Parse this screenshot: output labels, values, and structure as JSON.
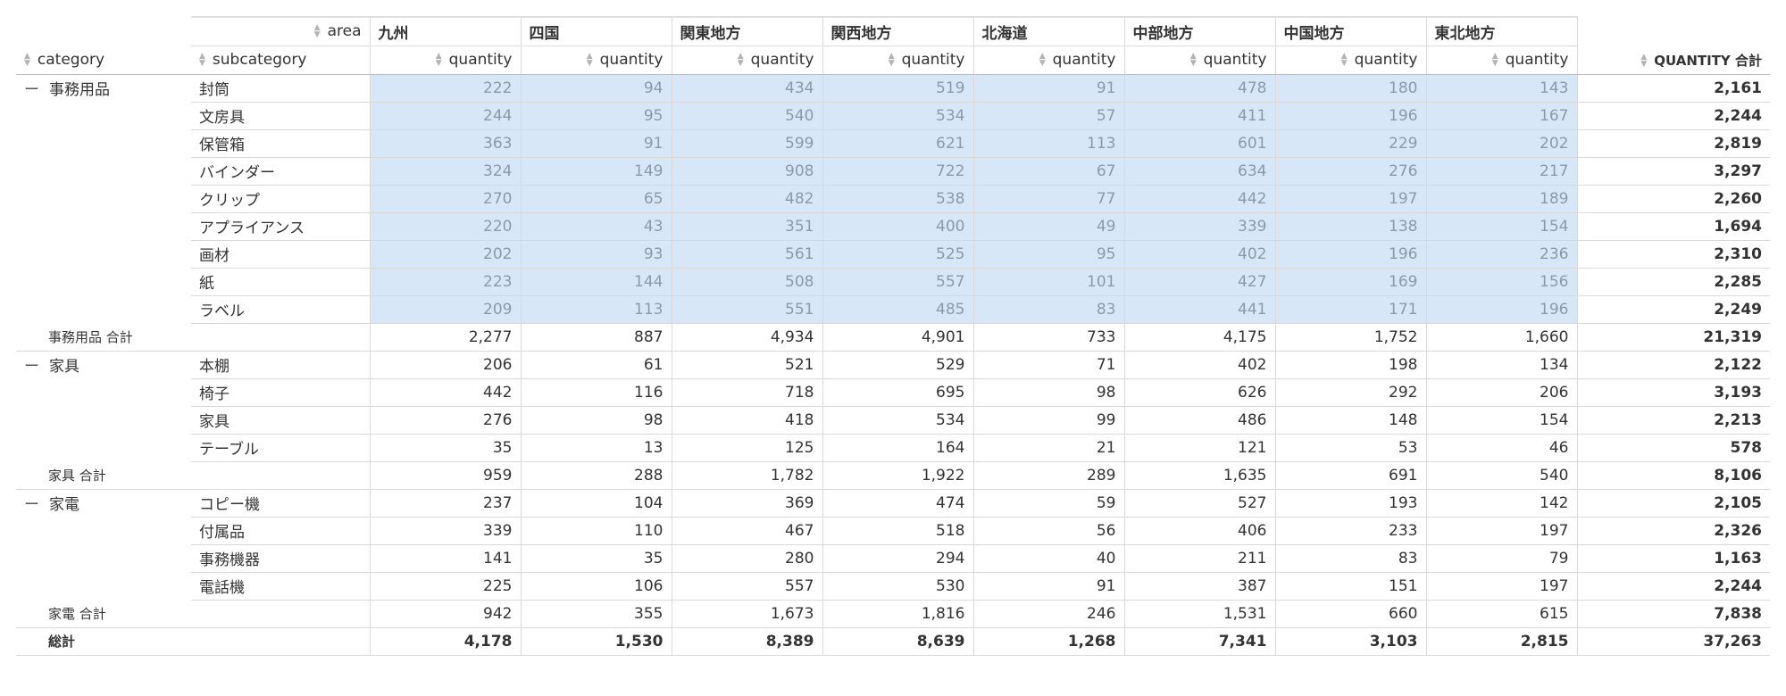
{
  "pivot": {
    "area_field": "area",
    "row_fields": [
      "category",
      "subcategory"
    ],
    "measure": "quantity",
    "total_header": "QUANTITY 合計",
    "areas": [
      "九州",
      "四国",
      "関東地方",
      "関西地方",
      "北海道",
      "中部地方",
      "中国地方",
      "東北地方"
    ],
    "groups": [
      {
        "category": "事務用品",
        "rows": [
          {
            "subcategory": "封筒",
            "values": [
              "222",
              "94",
              "434",
              "519",
              "91",
              "478",
              "180",
              "143"
            ],
            "total": "2,161"
          },
          {
            "subcategory": "文房具",
            "values": [
              "244",
              "95",
              "540",
              "534",
              "57",
              "411",
              "196",
              "167"
            ],
            "total": "2,244"
          },
          {
            "subcategory": "保管箱",
            "values": [
              "363",
              "91",
              "599",
              "621",
              "113",
              "601",
              "229",
              "202"
            ],
            "total": "2,819"
          },
          {
            "subcategory": "バインダー",
            "values": [
              "324",
              "149",
              "908",
              "722",
              "67",
              "634",
              "276",
              "217"
            ],
            "total": "3,297"
          },
          {
            "subcategory": "クリップ",
            "values": [
              "270",
              "65",
              "482",
              "538",
              "77",
              "442",
              "197",
              "189"
            ],
            "total": "2,260"
          },
          {
            "subcategory": "アプライアンス",
            "values": [
              "220",
              "43",
              "351",
              "400",
              "49",
              "339",
              "138",
              "154"
            ],
            "total": "1,694"
          },
          {
            "subcategory": "画材",
            "values": [
              "202",
              "93",
              "561",
              "525",
              "95",
              "402",
              "196",
              "236"
            ],
            "total": "2,310"
          },
          {
            "subcategory": "紙",
            "values": [
              "223",
              "144",
              "508",
              "557",
              "101",
              "427",
              "169",
              "156"
            ],
            "total": "2,285"
          },
          {
            "subcategory": "ラベル",
            "values": [
              "209",
              "113",
              "551",
              "485",
              "83",
              "441",
              "171",
              "196"
            ],
            "total": "2,249"
          }
        ],
        "subtotal_label": "事務用品 合計",
        "subtotal": [
          "2,277",
          "887",
          "4,934",
          "4,901",
          "733",
          "4,175",
          "1,752",
          "1,660"
        ],
        "subtotal_total": "21,319"
      },
      {
        "category": "家具",
        "rows": [
          {
            "subcategory": "本棚",
            "values": [
              "206",
              "61",
              "521",
              "529",
              "71",
              "402",
              "198",
              "134"
            ],
            "total": "2,122"
          },
          {
            "subcategory": "椅子",
            "values": [
              "442",
              "116",
              "718",
              "695",
              "98",
              "626",
              "292",
              "206"
            ],
            "total": "3,193"
          },
          {
            "subcategory": "家具",
            "values": [
              "276",
              "98",
              "418",
              "534",
              "99",
              "486",
              "148",
              "154"
            ],
            "total": "2,213"
          },
          {
            "subcategory": "テーブル",
            "values": [
              "35",
              "13",
              "125",
              "164",
              "21",
              "121",
              "53",
              "46"
            ],
            "total": "578"
          }
        ],
        "subtotal_label": "家具 合計",
        "subtotal": [
          "959",
          "288",
          "1,782",
          "1,922",
          "289",
          "1,635",
          "691",
          "540"
        ],
        "subtotal_total": "8,106"
      },
      {
        "category": "家電",
        "rows": [
          {
            "subcategory": "コピー機",
            "values": [
              "237",
              "104",
              "369",
              "474",
              "59",
              "527",
              "193",
              "142"
            ],
            "total": "2,105"
          },
          {
            "subcategory": "付属品",
            "values": [
              "339",
              "110",
              "467",
              "518",
              "56",
              "406",
              "233",
              "197"
            ],
            "total": "2,326"
          },
          {
            "subcategory": "事務機器",
            "values": [
              "141",
              "35",
              "280",
              "294",
              "40",
              "211",
              "83",
              "79"
            ],
            "total": "1,163"
          },
          {
            "subcategory": "電話機",
            "values": [
              "225",
              "106",
              "557",
              "530",
              "91",
              "387",
              "151",
              "197"
            ],
            "total": "2,244"
          }
        ],
        "subtotal_label": "家電 合計",
        "subtotal": [
          "942",
          "355",
          "1,673",
          "1,816",
          "246",
          "1,531",
          "660",
          "615"
        ],
        "subtotal_total": "7,838"
      }
    ],
    "grand_total_label": "総計",
    "grand_total": [
      "4,178",
      "1,530",
      "8,389",
      "8,639",
      "1,268",
      "7,341",
      "3,103",
      "2,815"
    ],
    "grand_total_total": "37,263",
    "collapse_symbol": "ー",
    "colors": {
      "selection_bg": "#d8e7f7",
      "selection_text": "#8a9aa9",
      "grid_line": "#d9d9d9",
      "text": "#333333"
    },
    "icons": {
      "sort": "sort-arrows-icon",
      "collapse": "collapse-minus-icon"
    }
  }
}
